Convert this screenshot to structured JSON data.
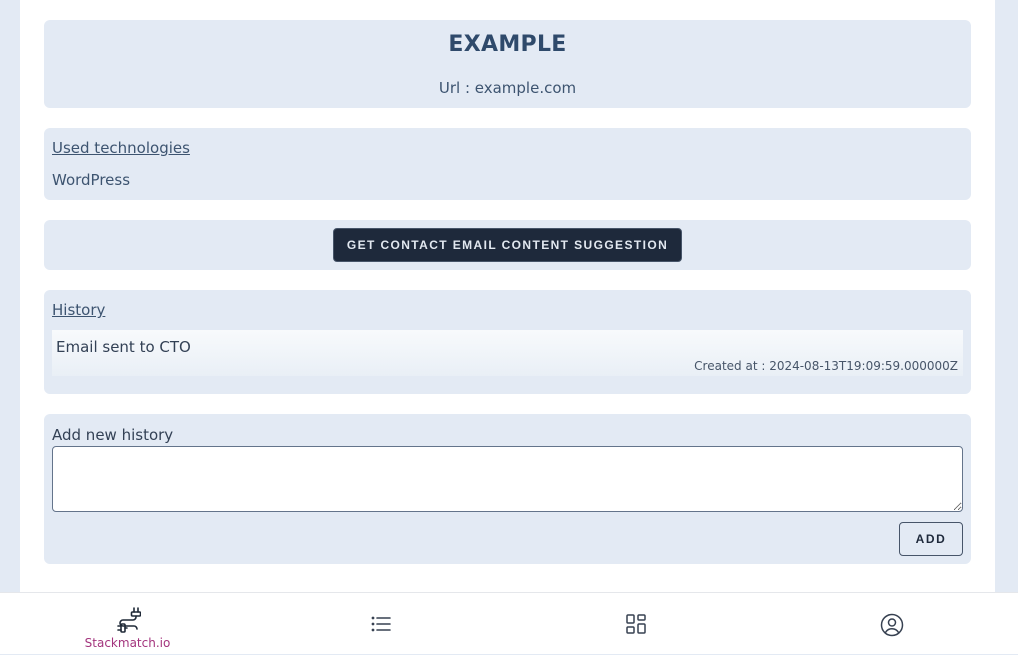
{
  "header": {
    "title": "EXAMPLE",
    "url_text": "Url : example.com"
  },
  "technologies": {
    "heading": "Used technologies",
    "items": [
      "WordPress"
    ]
  },
  "suggestion": {
    "button_label": "GET CONTACT EMAIL CONTENT SUGGESTION"
  },
  "history": {
    "heading": "History",
    "entries": [
      {
        "text": "Email sent to CTO",
        "created": "Created at : 2024-08-13T19:09:59.000000Z"
      }
    ]
  },
  "add_history": {
    "label": "Add new history",
    "value": "",
    "button_label": "ADD"
  },
  "bottom_nav": {
    "items": [
      {
        "icon": "plug-route-icon",
        "label": "Stackmatch.io",
        "active": true
      },
      {
        "icon": "list-icon",
        "label": ""
      },
      {
        "icon": "grid-icon",
        "label": ""
      },
      {
        "icon": "user-circle-icon",
        "label": ""
      }
    ]
  },
  "colors": {
    "accent": "#a3347d",
    "card_bg": "#e3eaf4",
    "button_dark": "#1e293b"
  }
}
